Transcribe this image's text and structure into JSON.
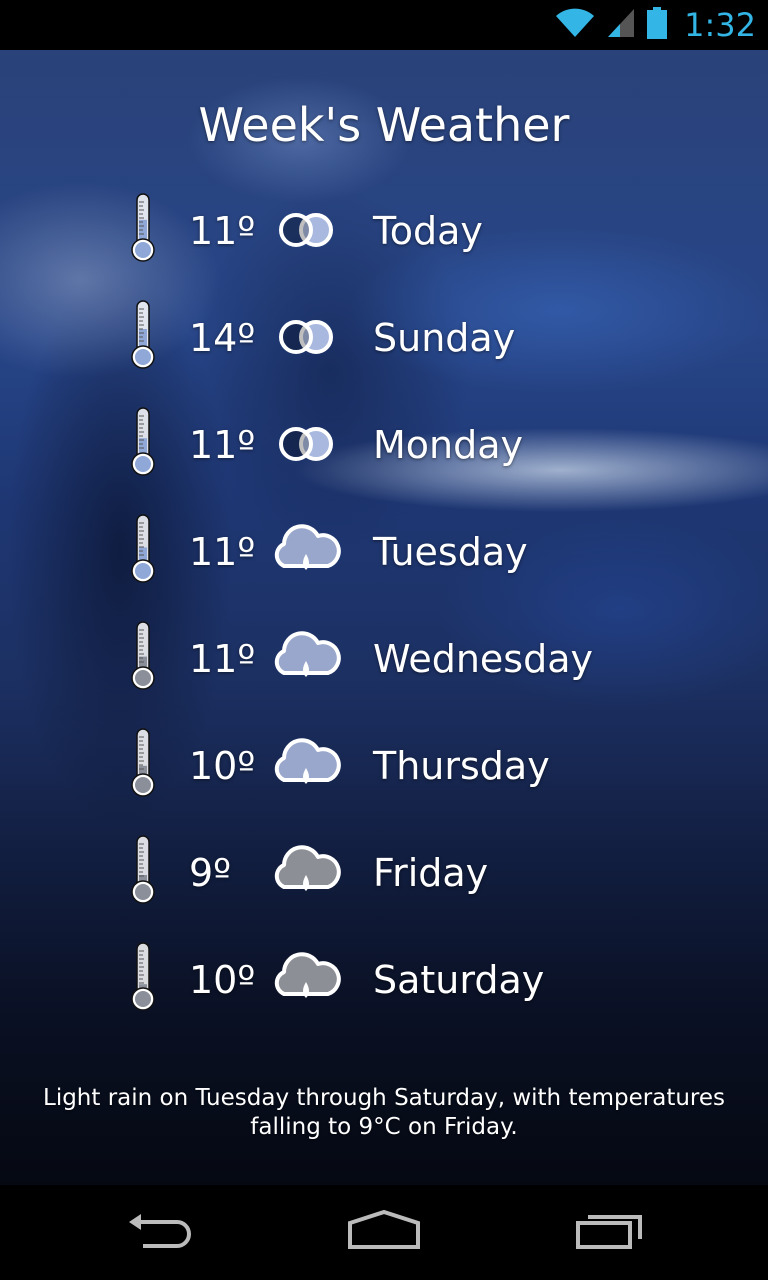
{
  "status_bar": {
    "time": "1:32",
    "accent_color": "#33b5e5",
    "icons": [
      "wifi-icon",
      "cell-signal-icon",
      "battery-icon"
    ]
  },
  "title": "Week's Weather",
  "forecast": [
    {
      "temp": "11º",
      "day": "Today",
      "icon": "partly-cloudy-icon",
      "level": 0.55
    },
    {
      "temp": "14º",
      "day": "Sunday",
      "icon": "partly-cloudy-icon",
      "level": 0.5
    },
    {
      "temp": "11º",
      "day": "Monday",
      "icon": "partly-cloudy-icon",
      "level": 0.45
    },
    {
      "temp": "11º",
      "day": "Tuesday",
      "icon": "rain-cloud-icon",
      "level": 0.4
    },
    {
      "temp": "11º",
      "day": "Wednesday",
      "icon": "rain-cloud-icon",
      "level": 0.35
    },
    {
      "temp": "10º",
      "day": "Thursday",
      "icon": "rain-cloud-icon",
      "level": 0.3
    },
    {
      "temp": "9º",
      "day": "Friday",
      "icon": "rain-cloud-icon",
      "level": 0.25
    },
    {
      "temp": "10º",
      "day": "Saturday",
      "icon": "rain-cloud-icon",
      "level": 0.2
    }
  ],
  "summary": "Light rain on Tuesday through Saturday, with temperatures falling to 9°C on Friday.",
  "nav": {
    "buttons": [
      "back-icon",
      "home-icon",
      "recent-apps-icon"
    ]
  }
}
